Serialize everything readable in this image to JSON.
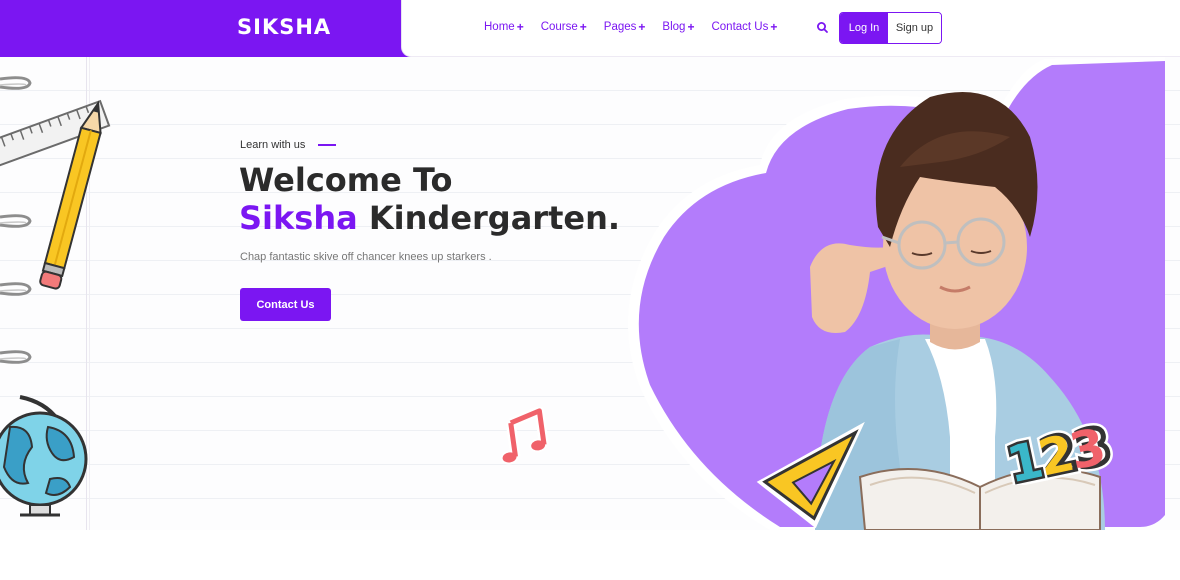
{
  "brand": {
    "name": "SIKSHA",
    "accent_color": "#7b16f2"
  },
  "nav": {
    "items": [
      {
        "label": "Home",
        "plus": "+"
      },
      {
        "label": "Course",
        "plus": "+"
      },
      {
        "label": "Pages",
        "plus": "+"
      },
      {
        "label": "Blog",
        "plus": "+"
      },
      {
        "label": "Contact Us",
        "plus": "+"
      }
    ],
    "search_icon": "search-icon",
    "login_label": "Log In",
    "signup_label": "Sign up"
  },
  "hero": {
    "tagline": "Learn with us",
    "title_line1": "Welcome To",
    "title_accent": "Siksha",
    "title_rest": " Kindergarten.",
    "subtitle": "Chap fantastic skive off chancer knees up starkers .",
    "cta_label": "Contact Us",
    "numbers_sticker": [
      "1",
      "2",
      "3"
    ]
  }
}
